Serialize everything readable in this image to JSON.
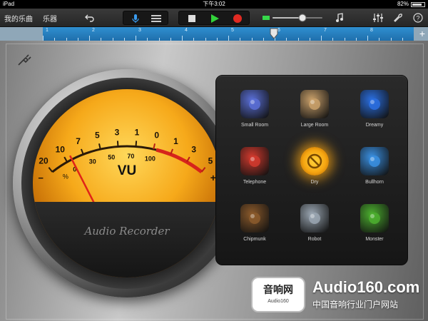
{
  "status_bar": {
    "device": "iPad",
    "time": "下午3:02",
    "battery_text": "82%",
    "battery_level": 0.82
  },
  "toolbar": {
    "my_songs": "我的乐曲",
    "instruments": "乐器",
    "volume_level": 0.6
  },
  "ruler": {
    "labels": [
      "1",
      "2",
      "3",
      "4",
      "5",
      "6",
      "7",
      "8"
    ]
  },
  "vu_meter": {
    "scale_top": [
      "20",
      "10",
      "7",
      "5",
      "3",
      "1",
      "0",
      "1",
      "3",
      "5"
    ],
    "scale_bottom": [
      "0",
      "30",
      "50",
      "70",
      "100"
    ],
    "percent_symbol": "%",
    "minus_symbol": "−",
    "plus_symbol": "+",
    "label": "VU",
    "brand": "Audio Recorder"
  },
  "effects": [
    {
      "name": "Small Room",
      "icon": "small-room-icon",
      "color": "#5a6fd6"
    },
    {
      "name": "Large Room",
      "icon": "large-room-icon",
      "color": "#c9a06a"
    },
    {
      "name": "Dreamy",
      "icon": "dreamy-icon",
      "color": "#2b6fe0"
    },
    {
      "name": "Telephone",
      "icon": "telephone-icon",
      "color": "#d13a2e"
    },
    {
      "name": "Dry",
      "icon": "dry-icon",
      "color": "#f2b21a",
      "selected": true
    },
    {
      "name": "Bullhorn",
      "icon": "bullhorn-icon",
      "color": "#3a8fe0"
    },
    {
      "name": "Chipmunk",
      "icon": "chipmunk-icon",
      "color": "#8b5a2b"
    },
    {
      "name": "Robot",
      "icon": "robot-icon",
      "color": "#9aa6b2"
    },
    {
      "name": "Monster",
      "icon": "monster-icon",
      "color": "#4caf2f"
    }
  ],
  "watermark": {
    "badge_cn": "音响网",
    "badge_en": "Audio160",
    "site": "Audio160.com",
    "slogan": "中国音响行业门户网站"
  }
}
